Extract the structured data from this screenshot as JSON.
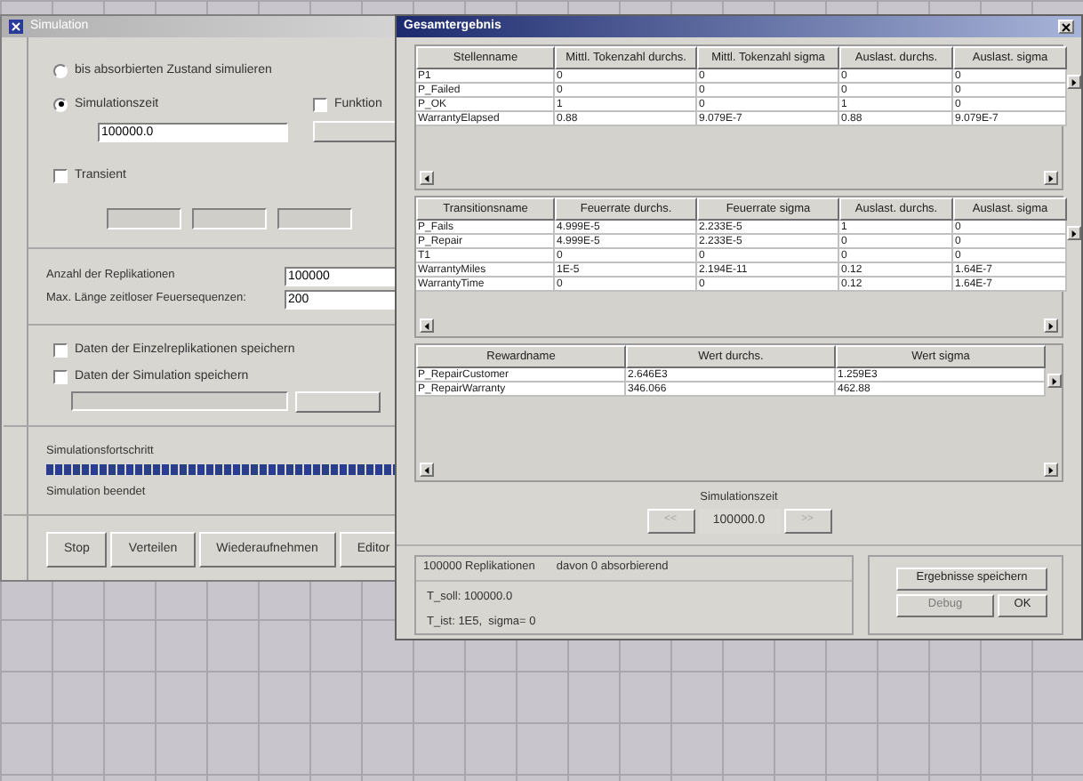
{
  "simulation_window": {
    "title": "Simulation",
    "mode_options": [
      {
        "label": "bis absorbierten Zustand simulieren",
        "selected": false
      },
      {
        "label": "Simulationszeit",
        "selected": true
      }
    ],
    "function_checkbox": {
      "label": "Funktion",
      "checked": false
    },
    "time_value": "100000.0",
    "transient": {
      "label": "Transient",
      "checked": false
    },
    "replications": {
      "label": "Anzahl der Replikationen",
      "value": "100000"
    },
    "max_length": {
      "label": "Max. Länge zeitloser Feuersequenzen:",
      "value": "200"
    },
    "save_options": [
      {
        "label": "Daten der Einzelreplikationen speichern",
        "checked": false
      },
      {
        "label": "Daten der Simulation speichern",
        "checked": false
      }
    ],
    "progress": {
      "label": "Simulationsfortschritt",
      "level": 1,
      "status": "Simulation beendet"
    },
    "buttons": [
      "Stop",
      "Verteilen",
      "Wiederaufnehmen",
      "Editor"
    ]
  },
  "result_window": {
    "title": "Gesamtergebnis",
    "tables": [
      {
        "columns": [
          "Stellenname",
          "Mittl. Tokenzahl durchs.",
          "Mittl. Tokenzahl sigma",
          "Auslast. durchs.",
          "Auslast. sigma"
        ],
        "rows": [
          [
            "P1",
            "0",
            "0",
            "0",
            "0"
          ],
          [
            "P_Failed",
            "0",
            "0",
            "0",
            "0"
          ],
          [
            "P_OK",
            "1",
            "0",
            "1",
            "0"
          ],
          [
            "WarrantyElapsed",
            "0.88",
            "9.079E-7",
            "0.88",
            "9.079E-7"
          ]
        ]
      },
      {
        "columns": [
          "Transitionsname",
          "Feuerrate durchs.",
          "Feuerrate sigma",
          "Auslast. durchs.",
          "Auslast. sigma"
        ],
        "rows": [
          [
            "P_Fails",
            "4.999E-5",
            "2.233E-5",
            "1",
            "0"
          ],
          [
            "P_Repair",
            "4.999E-5",
            "2.233E-5",
            "0",
            "0"
          ],
          [
            "T1",
            "0",
            "0",
            "0",
            "0"
          ],
          [
            "WarrantyMiles",
            "1E-5",
            "2.194E-11",
            "0.12",
            "1.64E-7"
          ],
          [
            "WarrantyTime",
            "0",
            "0",
            "0.12",
            "1.64E-7"
          ]
        ]
      },
      {
        "columns": [
          "Rewardname",
          "Wert durchs.",
          "Wert sigma"
        ],
        "rows": [
          [
            "P_RepairCustomer",
            "2.646E3",
            "1.259E3"
          ],
          [
            "P_RepairWarranty",
            "346.066",
            "462.88"
          ]
        ]
      }
    ],
    "time": {
      "label": "Simulationszeit",
      "value": "100000.0",
      "prev": "<<",
      "next": ">>"
    },
    "summary": {
      "replications": "100000 Replikationen",
      "absorbing": "davon 0 absorbierend",
      "t_target": "T_soll: 100000.0",
      "t_actual": "T_ist: 1E5,  sigma= 0"
    },
    "buttons": [
      {
        "label": "Ergebnisse speichern",
        "disabled": false
      },
      {
        "label": "Debug",
        "disabled": true
      },
      {
        "label": "OK",
        "disabled": false
      }
    ]
  }
}
